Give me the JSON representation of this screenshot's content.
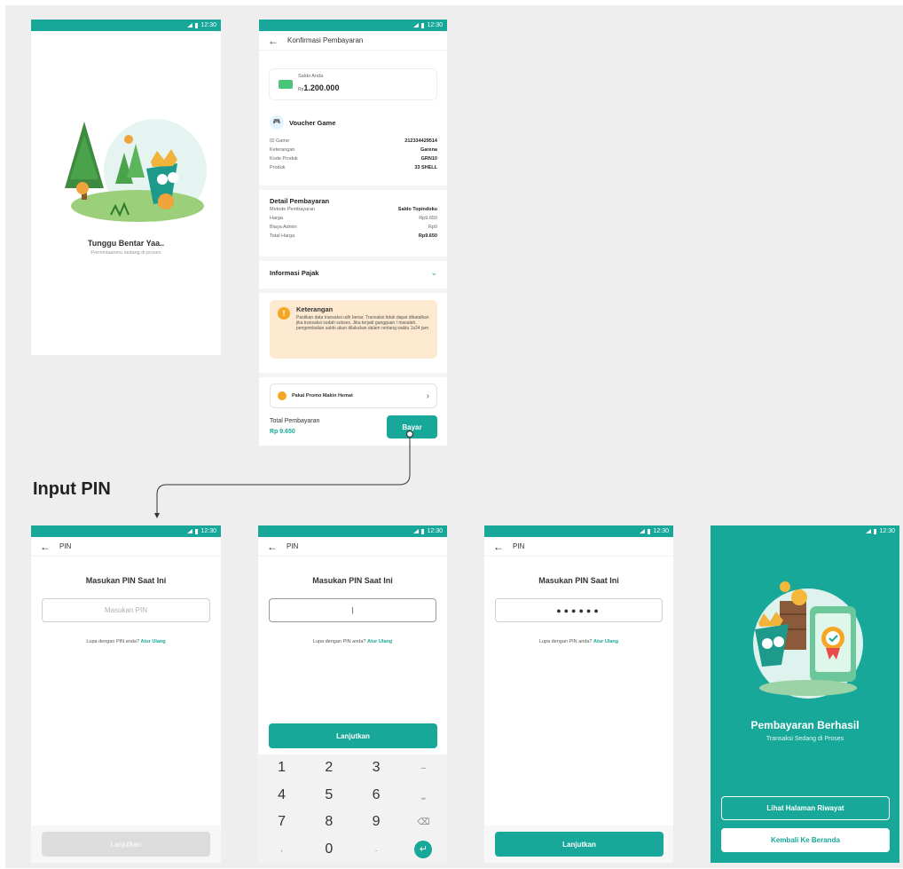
{
  "status": {
    "time": "12:30"
  },
  "loading": {
    "title": "Tunggu Bentar Yaa..",
    "subtitle": "Permintaanmu sedang di proses"
  },
  "confirm": {
    "title": "Konfirmasi Pembayaran",
    "balance_label": "Saldo Anda",
    "balance_prefix": "Rp",
    "balance_value": "1.200.000",
    "voucher_title": "Voucher Game",
    "voucher_rows": [
      {
        "label": "ID Game",
        "value": "212334429514"
      },
      {
        "label": "Keterangan",
        "value": "Garena"
      },
      {
        "label": "Kode Produk",
        "value": "GRN10"
      },
      {
        "label": "Produk",
        "value": "33 SHELL"
      }
    ],
    "detail_title": "Detail Pembayaran",
    "detail_rows": [
      {
        "label": "Metode Pembayaran",
        "value": "Saldo Topindoku"
      },
      {
        "label": "Harga",
        "value": "Rp9.650"
      },
      {
        "label": "Biaya Admin",
        "value": "Rp0"
      },
      {
        "label": "Total Harga",
        "value": "Rp9.650"
      }
    ],
    "tax_title": "Informasi Pajak",
    "note_title": "Keterangan",
    "note_text": "Pastikan data transaksi udh benar. Transaksi tidak dapat dibatalkan jika transaksi sudah sukses. Jika terjadi gangguan / masalah, pengembalian saldo akan dilakukan dalam rentang waktu 1x24 jam",
    "promo_label": "Pakai Promo Makin Hemat",
    "total_label": "Total Pembayaran",
    "total_value": "Rp 9.650",
    "pay_button": "Bayar"
  },
  "section_label": "Input PIN",
  "pin": {
    "title": "PIN",
    "heading": "Masukan PIN Saat Ini",
    "placeholder": "Masukan PIN",
    "cursor": "|",
    "masked": "●●●●●●",
    "forgot": "Lupa dengan PIN anda?",
    "reset": "Atur Ulang",
    "continue": "Lanjutkan",
    "keys": [
      "1",
      "2",
      "3",
      "–",
      "4",
      "5",
      "6",
      "⎵",
      "7",
      "8",
      "9",
      "⌫",
      ",",
      "0",
      ".",
      "↵"
    ]
  },
  "success": {
    "title": "Pembayaran Berhasil",
    "subtitle": "Transaksi Sedang di Proses",
    "history_button": "Lihat Halaman Riwayat",
    "home_button": "Kembali Ke Beranda"
  },
  "colors": {
    "accent": "#17a89a",
    "note_bg": "#fde9cf",
    "note_icon": "#f5a623"
  }
}
